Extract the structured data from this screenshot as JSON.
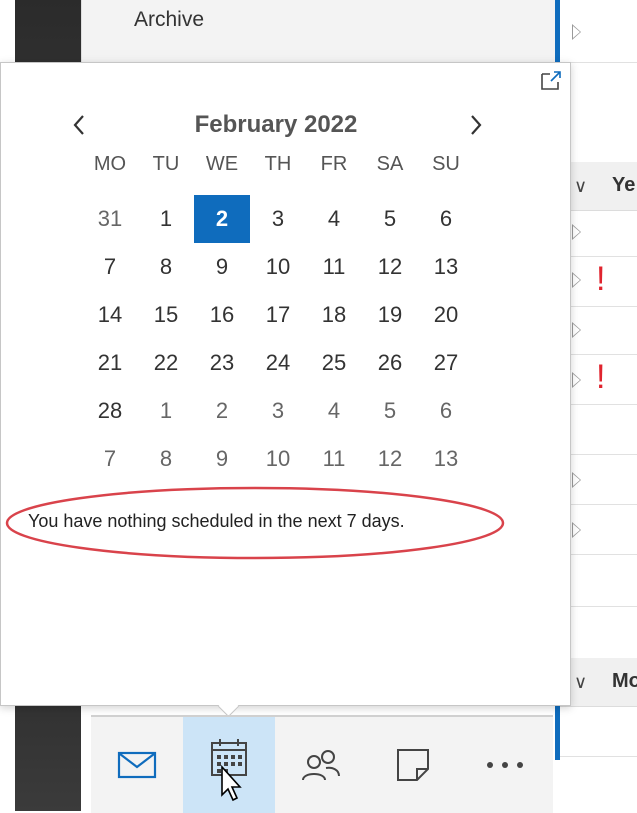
{
  "folders": {
    "archive": "Archive"
  },
  "message_list": {
    "groups": [
      {
        "label": "Ye"
      },
      {
        "label": "Mo"
      }
    ]
  },
  "calendar": {
    "month_title": "February 2022",
    "weekdays": [
      "MO",
      "TU",
      "WE",
      "TH",
      "FR",
      "SA",
      "SU"
    ],
    "weeks": [
      [
        {
          "d": "31",
          "other": true
        },
        {
          "d": "1"
        },
        {
          "d": "2",
          "today": true
        },
        {
          "d": "3"
        },
        {
          "d": "4"
        },
        {
          "d": "5"
        },
        {
          "d": "6"
        }
      ],
      [
        {
          "d": "7"
        },
        {
          "d": "8"
        },
        {
          "d": "9"
        },
        {
          "d": "10"
        },
        {
          "d": "11"
        },
        {
          "d": "12"
        },
        {
          "d": "13"
        }
      ],
      [
        {
          "d": "14"
        },
        {
          "d": "15"
        },
        {
          "d": "16"
        },
        {
          "d": "17"
        },
        {
          "d": "18"
        },
        {
          "d": "19"
        },
        {
          "d": "20"
        }
      ],
      [
        {
          "d": "21"
        },
        {
          "d": "22"
        },
        {
          "d": "23"
        },
        {
          "d": "24"
        },
        {
          "d": "25"
        },
        {
          "d": "26"
        },
        {
          "d": "27"
        }
      ],
      [
        {
          "d": "28"
        },
        {
          "d": "1",
          "other": true
        },
        {
          "d": "2",
          "other": true
        },
        {
          "d": "3",
          "other": true
        },
        {
          "d": "4",
          "other": true
        },
        {
          "d": "5",
          "other": true
        },
        {
          "d": "6",
          "other": true
        }
      ],
      [
        {
          "d": "7",
          "other": true
        },
        {
          "d": "8",
          "other": true
        },
        {
          "d": "9",
          "other": true
        },
        {
          "d": "10",
          "other": true
        },
        {
          "d": "11",
          "other": true
        },
        {
          "d": "12",
          "other": true
        },
        {
          "d": "13",
          "other": true
        }
      ]
    ]
  },
  "agenda_message": "You have nothing scheduled in the next 7 days.",
  "bottom_nav": {
    "items": [
      {
        "icon": "mail-icon"
      },
      {
        "icon": "calendar-icon",
        "active": true
      },
      {
        "icon": "people-icon"
      },
      {
        "icon": "notes-icon"
      },
      {
        "icon": "more-icon"
      }
    ]
  },
  "colors": {
    "accent": "#0f6cbd",
    "annotation": "#d9434b",
    "importance": "#e0242e",
    "active_nav": "#cce4f7"
  }
}
